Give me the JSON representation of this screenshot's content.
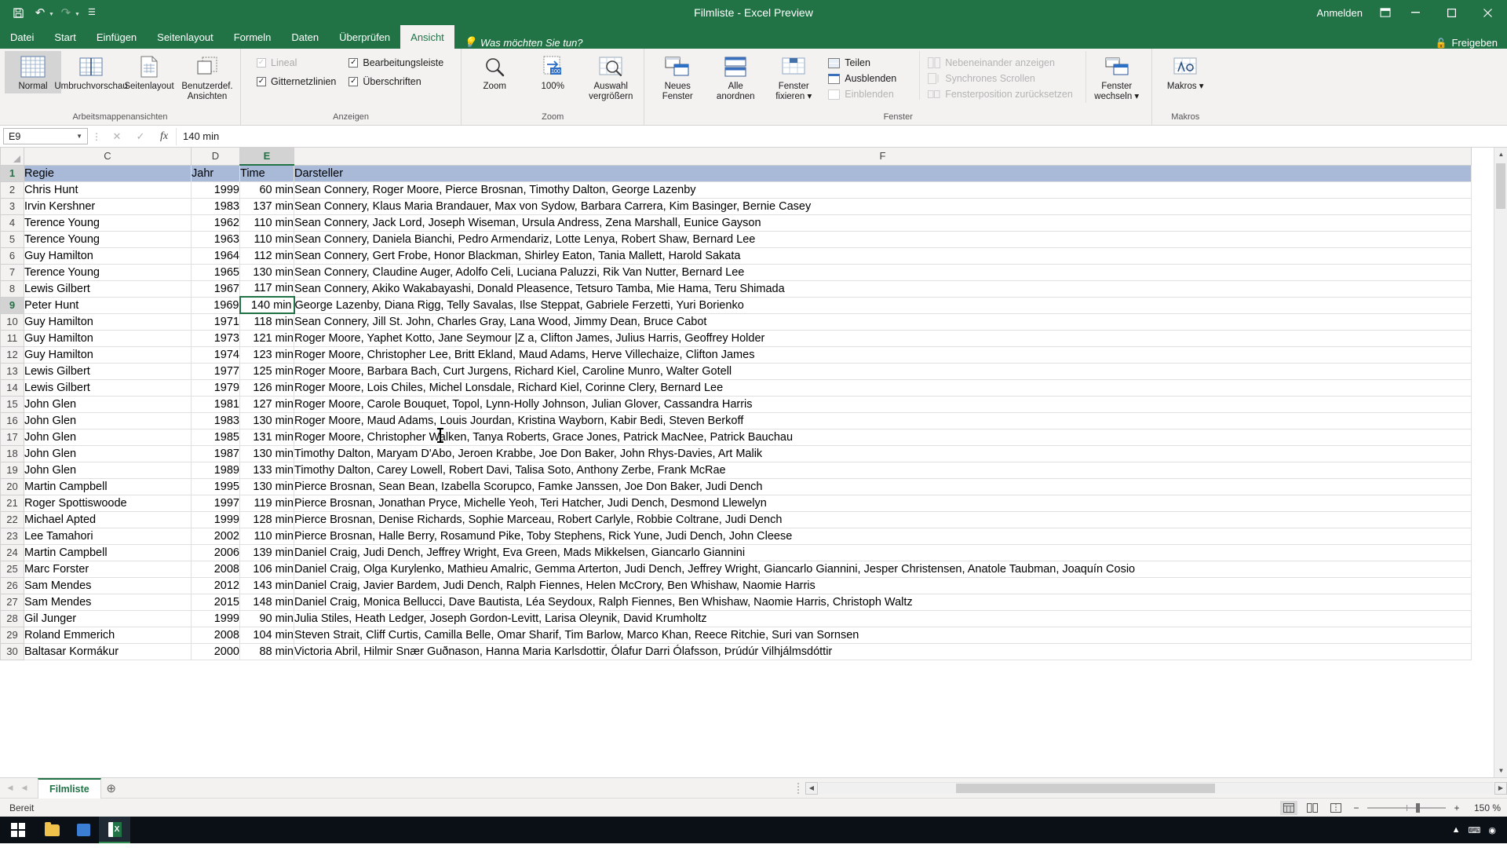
{
  "titlebar": {
    "title": "Filmliste - Excel Preview",
    "quick_access": [
      {
        "name": "save",
        "glyph": "ὋE"
      },
      {
        "name": "undo",
        "glyph": "↶"
      },
      {
        "name": "redo",
        "glyph": "↷"
      },
      {
        "name": "customize",
        "glyph": "☷"
      }
    ],
    "signin_label": "Anmelden",
    "ribbon_display_icon": "❐",
    "minimize": "─",
    "restore": "❐",
    "close": "✕"
  },
  "tabs": [
    {
      "label": "Datei",
      "active": false
    },
    {
      "label": "Start",
      "active": false
    },
    {
      "label": "Einfügen",
      "active": false
    },
    {
      "label": "Seitenlayout",
      "active": false
    },
    {
      "label": "Formeln",
      "active": false
    },
    {
      "label": "Daten",
      "active": false
    },
    {
      "label": "Überprüfen",
      "active": false
    },
    {
      "label": "Ansicht",
      "active": true
    }
  ],
  "tellme": "Was möchten Sie tun?",
  "share_label": "Freigeben",
  "ribbon": {
    "groups": [
      {
        "name": "Arbeitsmappenansichten",
        "label": "Arbeitsmappenansichten",
        "buttons": [
          {
            "label": "Normal",
            "selected": true
          },
          {
            "label": "Umbruchvorschau",
            "selected": false
          },
          {
            "label": "Seitenlayout",
            "selected": false
          },
          {
            "label": "Benutzerdef. Ansichten",
            "selected": false
          }
        ]
      },
      {
        "name": "Anzeigen",
        "label": "Anzeigen",
        "checks": [
          {
            "label": "Lineal",
            "checked": true,
            "disabled": true
          },
          {
            "label": "Gitternetzlinien",
            "checked": true,
            "disabled": false
          },
          {
            "label": "Bearbeitungsleiste",
            "checked": true,
            "disabled": false
          },
          {
            "label": "Überschriften",
            "checked": true,
            "disabled": false
          }
        ]
      },
      {
        "name": "Zoom",
        "label": "Zoom",
        "buttons": [
          {
            "label": "Zoom",
            "selected": false
          },
          {
            "label": "100%",
            "selected": false
          },
          {
            "label": "Auswahl vergrößern",
            "selected": false
          }
        ]
      },
      {
        "name": "Fenster",
        "label": "Fenster",
        "buttons": [
          {
            "label": "Neues Fenster",
            "selected": false
          },
          {
            "label": "Alle anordnen",
            "selected": false
          },
          {
            "label": "Fenster fixieren ▾",
            "selected": false
          }
        ],
        "small_left": [
          {
            "label": "Teilen",
            "disabled": false
          },
          {
            "label": "Ausblenden",
            "disabled": false
          },
          {
            "label": "Einblenden",
            "disabled": true
          }
        ],
        "small_right": [
          {
            "label": "Nebeneinander anzeigen",
            "disabled": true
          },
          {
            "label": "Synchrones Scrollen",
            "disabled": true
          },
          {
            "label": "Fensterposition zurücksetzen",
            "disabled": true
          }
        ],
        "switch_button": "Fenster wechseln ▾"
      },
      {
        "name": "Makros",
        "label": "Makros",
        "buttons": [
          {
            "label": "Makros ▾",
            "selected": false
          }
        ]
      }
    ]
  },
  "formula_bar": {
    "name_box": "E9",
    "cancel_icon": "✕",
    "confirm_icon": "✓",
    "fx_icon": "fx",
    "value": "140 min"
  },
  "grid": {
    "columns": [
      "C",
      "D",
      "E",
      "F"
    ],
    "selected_column": "E",
    "selected_cell": {
      "row": 9,
      "column": "E"
    },
    "header_row_index": 1,
    "headers": {
      "C": "Regie",
      "D": "Jahr",
      "E": "Time",
      "F": "Darsteller"
    },
    "rows": [
      {
        "n": 1,
        "C": "Regie",
        "D": "Jahr",
        "E": "Time",
        "F": "Darsteller"
      },
      {
        "n": 2,
        "C": "Chris Hunt",
        "D": "1999",
        "E": "60 min",
        "F": "Sean Connery, Roger Moore, Pierce Brosnan, Timothy Dalton, George Lazenby"
      },
      {
        "n": 3,
        "C": "Irvin Kershner",
        "D": "1983",
        "E": "137 min",
        "F": "Sean Connery, Klaus Maria Brandauer, Max von Sydow, Barbara Carrera, Kim Basinger, Bernie Casey"
      },
      {
        "n": 4,
        "C": "Terence Young",
        "D": "1962",
        "E": "110 min",
        "F": "Sean Connery, Jack Lord, Joseph Wiseman, Ursula Andress, Zena Marshall, Eunice Gayson"
      },
      {
        "n": 5,
        "C": "Terence Young",
        "D": "1963",
        "E": "110 min",
        "F": "Sean Connery, Daniela Bianchi, Pedro Armendariz, Lotte Lenya, Robert Shaw, Bernard Lee"
      },
      {
        "n": 6,
        "C": "Guy Hamilton",
        "D": "1964",
        "E": "112 min",
        "F": "Sean Connery, Gert Frobe, Honor Blackman, Shirley Eaton, Tania Mallett, Harold Sakata"
      },
      {
        "n": 7,
        "C": "Terence Young",
        "D": "1965",
        "E": "130 min",
        "F": "Sean Connery, Claudine Auger, Adolfo Celi, Luciana Paluzzi, Rik Van Nutter, Bernard Lee"
      },
      {
        "n": 8,
        "C": "Lewis Gilbert",
        "D": "1967",
        "E": "117 min",
        "F": "Sean Connery, Akiko Wakabayashi, Donald Pleasence, Tetsuro Tamba, Mie Hama, Teru Shimada"
      },
      {
        "n": 9,
        "C": "Peter Hunt",
        "D": "1969",
        "E": "140 min",
        "F": "George Lazenby, Diana Rigg, Telly Savalas, Ilse Steppat, Gabriele Ferzetti, Yuri Borienko"
      },
      {
        "n": 10,
        "C": "Guy Hamilton",
        "D": "1971",
        "E": "118 min",
        "F": "Sean Connery, Jill St. John, Charles Gray, Lana Wood, Jimmy Dean, Bruce Cabot"
      },
      {
        "n": 11,
        "C": "Guy Hamilton",
        "D": "1973",
        "E": "121 min",
        "F": "Roger Moore, Yaphet Kotto, Jane Seymour |Z a, Clifton James, Julius Harris, Geoffrey Holder"
      },
      {
        "n": 12,
        "C": "Guy Hamilton",
        "D": "1974",
        "E": "123 min",
        "F": "Roger Moore, Christopher Lee, Britt Ekland, Maud Adams, Herve Villechaize, Clifton James"
      },
      {
        "n": 13,
        "C": "Lewis Gilbert",
        "D": "1977",
        "E": "125 min",
        "F": "Roger Moore, Barbara Bach, Curt Jurgens, Richard Kiel, Caroline Munro, Walter Gotell"
      },
      {
        "n": 14,
        "C": "Lewis Gilbert",
        "D": "1979",
        "E": "126 min",
        "F": "Roger Moore, Lois Chiles, Michel Lonsdale, Richard Kiel, Corinne Clery, Bernard Lee"
      },
      {
        "n": 15,
        "C": "John Glen",
        "D": "1981",
        "E": "127 min",
        "F": "Roger Moore, Carole Bouquet, Topol, Lynn-Holly Johnson, Julian Glover, Cassandra Harris"
      },
      {
        "n": 16,
        "C": "John Glen",
        "D": "1983",
        "E": "130 min",
        "F": "Roger Moore, Maud Adams, Louis Jourdan, Kristina Wayborn, Kabir Bedi, Steven Berkoff"
      },
      {
        "n": 17,
        "C": "John Glen",
        "D": "1985",
        "E": "131 min",
        "F": "Roger Moore, Christopher Walken, Tanya Roberts, Grace Jones, Patrick MacNee, Patrick Bauchau"
      },
      {
        "n": 18,
        "C": "John Glen",
        "D": "1987",
        "E": "130 min",
        "F": "Timothy Dalton, Maryam D'Abo, Jeroen Krabbe, Joe Don Baker, John Rhys-Davies, Art Malik"
      },
      {
        "n": 19,
        "C": "John Glen",
        "D": "1989",
        "E": "133 min",
        "F": "Timothy Dalton, Carey Lowell, Robert Davi, Talisa Soto, Anthony Zerbe, Frank McRae"
      },
      {
        "n": 20,
        "C": "Martin Campbell",
        "D": "1995",
        "E": "130 min",
        "F": "Pierce Brosnan, Sean Bean, Izabella Scorupco, Famke Janssen, Joe Don Baker, Judi Dench"
      },
      {
        "n": 21,
        "C": "Roger Spottiswoode",
        "D": "1997",
        "E": "119 min",
        "F": "Pierce Brosnan, Jonathan Pryce, Michelle Yeoh, Teri Hatcher, Judi Dench, Desmond Llewelyn"
      },
      {
        "n": 22,
        "C": "Michael Apted",
        "D": "1999",
        "E": "128 min",
        "F": "Pierce Brosnan, Denise Richards, Sophie Marceau, Robert Carlyle, Robbie Coltrane, Judi Dench"
      },
      {
        "n": 23,
        "C": "Lee Tamahori",
        "D": "2002",
        "E": "110 min",
        "F": "Pierce Brosnan, Halle Berry, Rosamund Pike, Toby Stephens, Rick Yune, Judi Dench, John Cleese"
      },
      {
        "n": 24,
        "C": "Martin Campbell",
        "D": "2006",
        "E": "139 min",
        "F": "Daniel Craig, Judi Dench, Jeffrey Wright, Eva Green, Mads Mikkelsen, Giancarlo Giannini"
      },
      {
        "n": 25,
        "C": "Marc Forster",
        "D": "2008",
        "E": "106 min",
        "F": "Daniel Craig, Olga Kurylenko, Mathieu Amalric, Gemma Arterton, Judi Dench, Jeffrey Wright, Giancarlo Giannini, Jesper Christensen, Anatole Taubman, Joaquín Cosio"
      },
      {
        "n": 26,
        "C": "Sam Mendes",
        "D": "2012",
        "E": "143 min",
        "F": "Daniel Craig, Javier Bardem, Judi Dench, Ralph Fiennes, Helen McCrory, Ben Whishaw, Naomie Harris"
      },
      {
        "n": 27,
        "C": "Sam Mendes",
        "D": "2015",
        "E": "148 min",
        "F": "Daniel Craig, Monica Bellucci, Dave Bautista, Léa Seydoux, Ralph Fiennes, Ben Whishaw, Naomie Harris, Christoph Waltz"
      },
      {
        "n": 28,
        "C": "Gil Junger",
        "D": "1999",
        "E": "90 min",
        "F": "Julia Stiles, Heath Ledger, Joseph Gordon-Levitt, Larisa Oleynik, David Krumholtz"
      },
      {
        "n": 29,
        "C": "Roland Emmerich",
        "D": "2008",
        "E": "104 min",
        "F": "Steven Strait, Cliff Curtis, Camilla Belle, Omar Sharif, Tim Barlow, Marco Khan, Reece Ritchie, Suri van Sornsen"
      },
      {
        "n": 30,
        "C": "Baltasar Kormákur",
        "D": "2000",
        "E": "88 min",
        "F": "Victoria Abril, Hilmir Snær Guðnason, Hanna Maria Karlsdottir, Ólafur Darri Ólafsson, Þrúdúr Vilhjálmsdóttir"
      }
    ]
  },
  "sheetbar": {
    "tabs": [
      "Filmliste"
    ],
    "add_sheet_icon": "⊕",
    "nav_first": "◀",
    "nav_prev": "◀",
    "scroll_left": "◀",
    "scroll_right": "▶"
  },
  "statusbar": {
    "state": "Bereit",
    "views": [
      "normal-view",
      "page-layout-view",
      "page-break-view"
    ],
    "zoom_out": "−",
    "zoom_in": "+",
    "zoom_level": "150 %"
  },
  "taskbar": {
    "apps": [
      "start",
      "file-explorer",
      "microsoft-store",
      "excel"
    ],
    "tray_icons": [
      "▲",
      "⌨",
      "◉"
    ]
  }
}
